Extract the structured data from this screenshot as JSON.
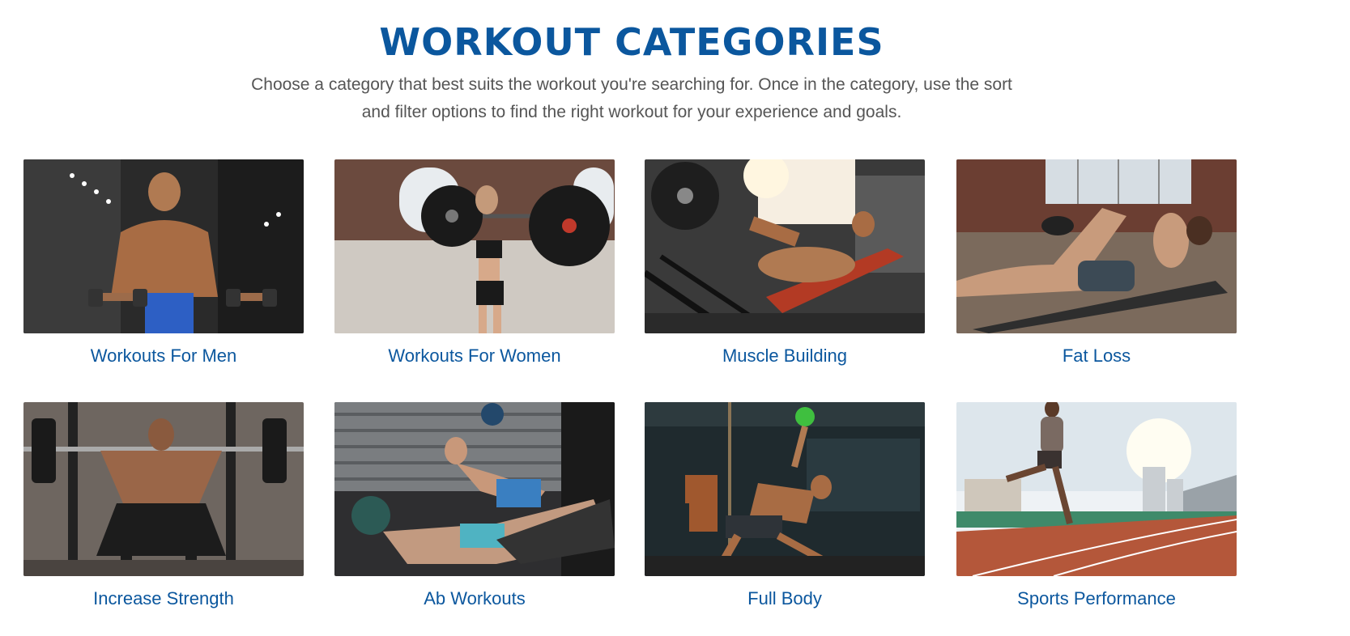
{
  "header": {
    "title": "WORKOUT CATEGORIES",
    "intro_line_1": "Choose a category that best suits the workout you're searching for. Once in the category, use the sort",
    "intro_line_2": "and filter options to find the right workout for your experience and goals."
  },
  "categories": [
    {
      "label": "Workouts For Men",
      "image": "man-dumbbell-curl-photo"
    },
    {
      "label": "Workouts For Women",
      "image": "woman-barbell-photo"
    },
    {
      "label": "Muscle Building",
      "image": "leg-press-photo"
    },
    {
      "label": "Fat Loss",
      "image": "woman-crunch-photo"
    },
    {
      "label": "Increase Strength",
      "image": "man-squat-photo"
    },
    {
      "label": "Ab Workouts",
      "image": "medicine-ball-situp-photo"
    },
    {
      "label": "Full Body",
      "image": "kettlebell-getup-photo"
    },
    {
      "label": "Sports Performance",
      "image": "track-runner-photo"
    }
  ]
}
